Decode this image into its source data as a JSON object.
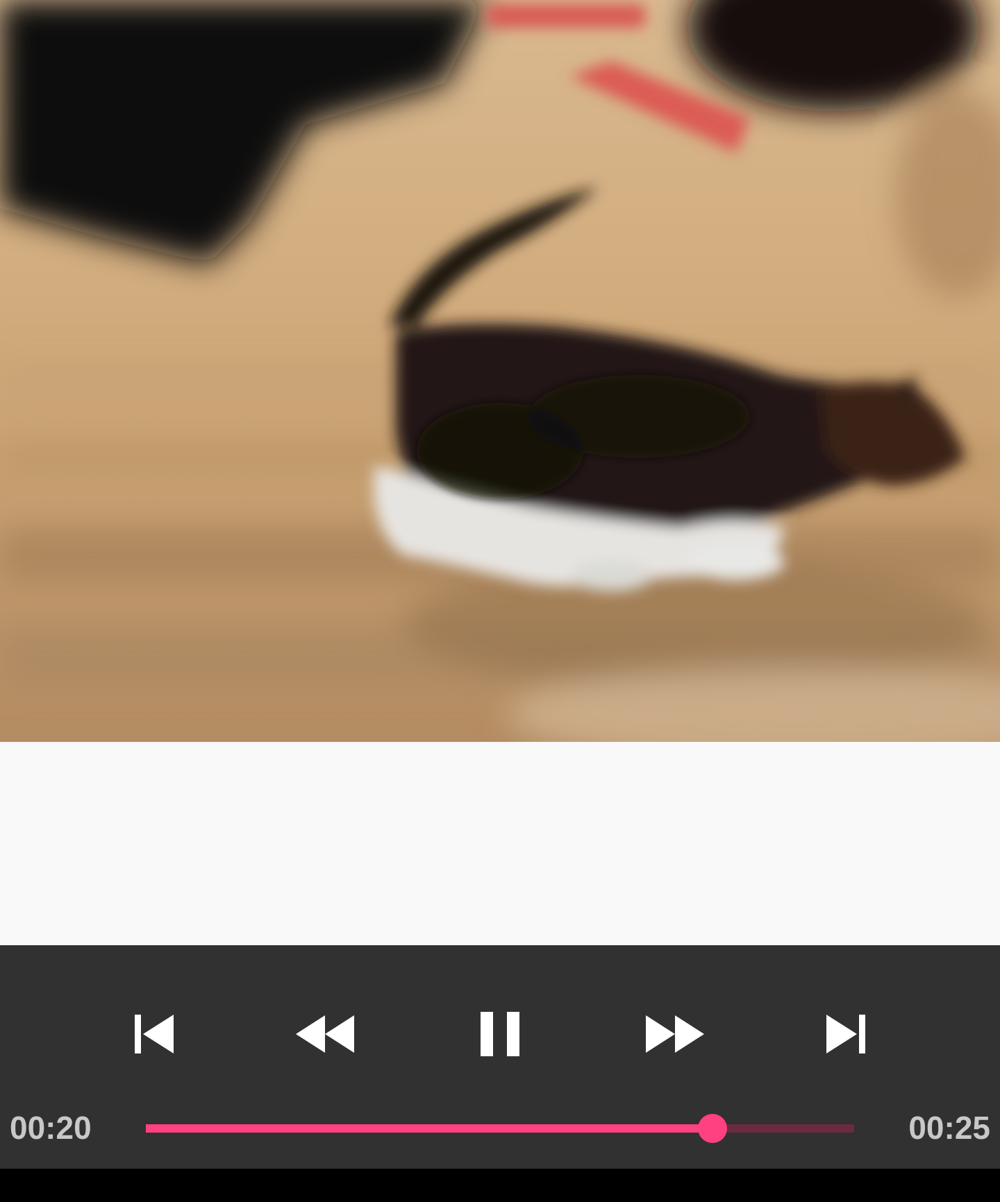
{
  "player": {
    "current_time": "00:20",
    "total_time": "00:25",
    "progress_fraction": 0.8,
    "state": "playing"
  },
  "controls": {
    "previous_icon": "skip-previous-icon",
    "rewind_icon": "rewind-icon",
    "pause_icon": "pause-icon",
    "fast_forward_icon": "fast-forward-icon",
    "next_icon": "skip-next-icon"
  },
  "colors": {
    "accent": "#ff4081",
    "track": "#6b2a42",
    "control_bar": "#313131",
    "time_text": "#c8c8c8",
    "icon": "#ffffff"
  }
}
